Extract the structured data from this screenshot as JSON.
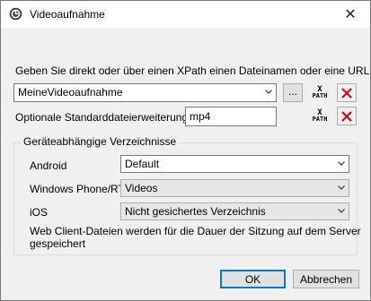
{
  "window": {
    "title": "Videoaufnahme",
    "close_glyph": "✕"
  },
  "instructions": "Geben Sie direkt oder über einen XPath einen Dateinamen oder eine URL an",
  "filename": {
    "value": "MeineVideoaufnahme",
    "browse_label": "..."
  },
  "extension": {
    "label": "Optionale Standarddateierweiterung",
    "value": "mp4"
  },
  "xpath_button": {
    "top": "X",
    "bottom": "PATH"
  },
  "group": {
    "title": "Geräteabhängige Verzeichnisse",
    "android_label": "Android",
    "android_value": "Default",
    "winphone_label": "Windows Phone/RT",
    "winphone_value": "Videos",
    "ios_label": "iOS",
    "ios_value": "Nicht gesichertes Verzeichnis",
    "note_line1": "Web Client-Dateien werden für die Dauer der Sitzung auf dem Server",
    "note_line2": "gespeichert"
  },
  "buttons": {
    "ok": "OK",
    "cancel": "Abbrechen"
  },
  "colors": {
    "delete_red": "#d0021b",
    "accent": "#0078d7"
  },
  "icons": [
    "app-icon",
    "close-icon",
    "chevron-down-icon",
    "xpath-icon",
    "delete-icon"
  ]
}
